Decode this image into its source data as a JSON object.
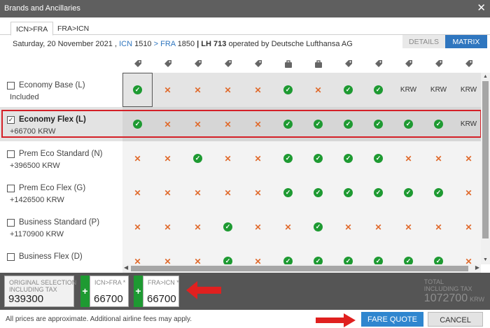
{
  "window": {
    "title": "Brands and Ancillaries",
    "close": "✕"
  },
  "tabs": [
    {
      "label": "ICN>FRA",
      "active": true
    },
    {
      "label": "FRA>ICN",
      "active": false
    }
  ],
  "view_toggle": {
    "details": "DETAILS",
    "matrix": "MATRIX",
    "active": "MATRIX"
  },
  "flight": {
    "date": "Saturday, 20 November 2021 ,",
    "origin": "ICN",
    "dep_time": "1510",
    "arrow": ">",
    "destination": "FRA",
    "arr_time": "1850",
    "pipe": "|",
    "carrier": "LH",
    "number": "713",
    "operated_by": "operated by Deutsche Lufthansa AG"
  },
  "column_icons": [
    "tag-icon",
    "tag-icon",
    "tag-icon",
    "tag-icon",
    "tag-icon",
    "bag-icon",
    "bag-icon",
    "tag-icon",
    "tag-icon",
    "tag-icon",
    "tag-icon",
    "tag-icon"
  ],
  "brands": [
    {
      "name": "Economy Base (L)",
      "price": "Included",
      "checked": false,
      "cells": [
        "ok",
        "x",
        "x",
        "x",
        "x",
        "ok",
        "x",
        "ok",
        "ok",
        "KRW",
        "KRW",
        "KRW"
      ]
    },
    {
      "name": "Economy Flex (L)",
      "price": "+66700 KRW",
      "checked": true,
      "cells": [
        "ok",
        "x",
        "x",
        "x",
        "x",
        "ok",
        "ok",
        "ok",
        "ok",
        "ok",
        "ok",
        "KRW"
      ]
    },
    {
      "name": "Prem Eco Standard (N)",
      "price": "+396500 KRW",
      "checked": false,
      "cells": [
        "x",
        "x",
        "ok",
        "x",
        "x",
        "ok",
        "ok",
        "ok",
        "ok",
        "x",
        "x",
        "x"
      ]
    },
    {
      "name": "Prem Eco Flex (G)",
      "price": "+1426500 KRW",
      "checked": false,
      "cells": [
        "x",
        "x",
        "x",
        "x",
        "x",
        "ok",
        "ok",
        "ok",
        "ok",
        "ok",
        "ok",
        "x"
      ]
    },
    {
      "name": "Business Standard (P)",
      "price": "+1170900 KRW",
      "checked": false,
      "cells": [
        "x",
        "x",
        "x",
        "ok",
        "x",
        "x",
        "ok",
        "x",
        "x",
        "x",
        "x",
        "x"
      ]
    },
    {
      "name": "Business Flex (D)",
      "price": "",
      "checked": false,
      "cells": [
        "x",
        "x",
        "x",
        "ok",
        "x",
        "ok",
        "ok",
        "ok",
        "ok",
        "ok",
        "ok",
        "x"
      ]
    }
  ],
  "summary": {
    "original": {
      "label1": "ORIGINAL SELECTION",
      "label2": "INCLUDING TAX",
      "value": "939300"
    },
    "seg1": {
      "label": "ICN>FRA *",
      "value": "66700"
    },
    "seg2": {
      "label": "FRA>ICN *",
      "value": "66700"
    },
    "plus": "+",
    "total": {
      "label1": "TOTAL",
      "label2": "INCLUDING TAX",
      "value": "1072700",
      "currency": "KRW"
    }
  },
  "footer": {
    "note": "All prices are approximate. Additional airline fees may apply.",
    "fare_quote": "FARE QUOTE",
    "cancel": "CANCEL"
  },
  "colors": {
    "check": "#1e9a32",
    "cross": "#e06a2c",
    "accent": "#2f76bf",
    "highlight": "#d42027"
  }
}
